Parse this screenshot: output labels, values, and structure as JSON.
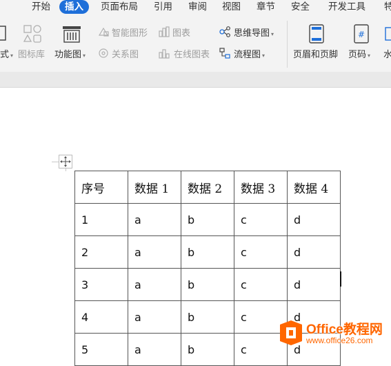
{
  "menu": {
    "items": [
      {
        "label": "开始",
        "active": false
      },
      {
        "label": "插入",
        "active": true
      },
      {
        "label": "页面布局",
        "active": false
      },
      {
        "label": "引用",
        "active": false
      },
      {
        "label": "审阅",
        "active": false
      },
      {
        "label": "视图",
        "active": false
      },
      {
        "label": "章节",
        "active": false
      },
      {
        "label": "安全",
        "active": false
      },
      {
        "label": "开发工具",
        "active": false
      },
      {
        "label": "特",
        "active": false
      }
    ]
  },
  "ribbon": {
    "partial_left_label": "式",
    "icon_library": "图标库",
    "function_chart": "功能图",
    "smart_shape": "智能图形",
    "chart": "图表",
    "relation_chart": "关系图",
    "online_chart": "在线图表",
    "mind_map": "思维导图",
    "flowchart": "流程图",
    "header_footer": "页眉和页脚",
    "page_number": "页码",
    "watermark_partial": "水"
  },
  "table": {
    "headers": [
      "序号",
      "数据 1",
      "数据 2",
      "数据 3",
      "数据 4"
    ],
    "rows": [
      [
        "1",
        "a",
        "b",
        "c",
        "d"
      ],
      [
        "2",
        "a",
        "b",
        "c",
        "d"
      ],
      [
        "3",
        "a",
        "b",
        "c",
        "d"
      ],
      [
        "4",
        "a",
        "b",
        "c",
        "d"
      ],
      [
        "5",
        "a",
        "b",
        "c",
        "d"
      ]
    ]
  },
  "watermark_logo": {
    "brand": "Office教程网",
    "url": "www.office26.com",
    "color": "#ff6600"
  }
}
